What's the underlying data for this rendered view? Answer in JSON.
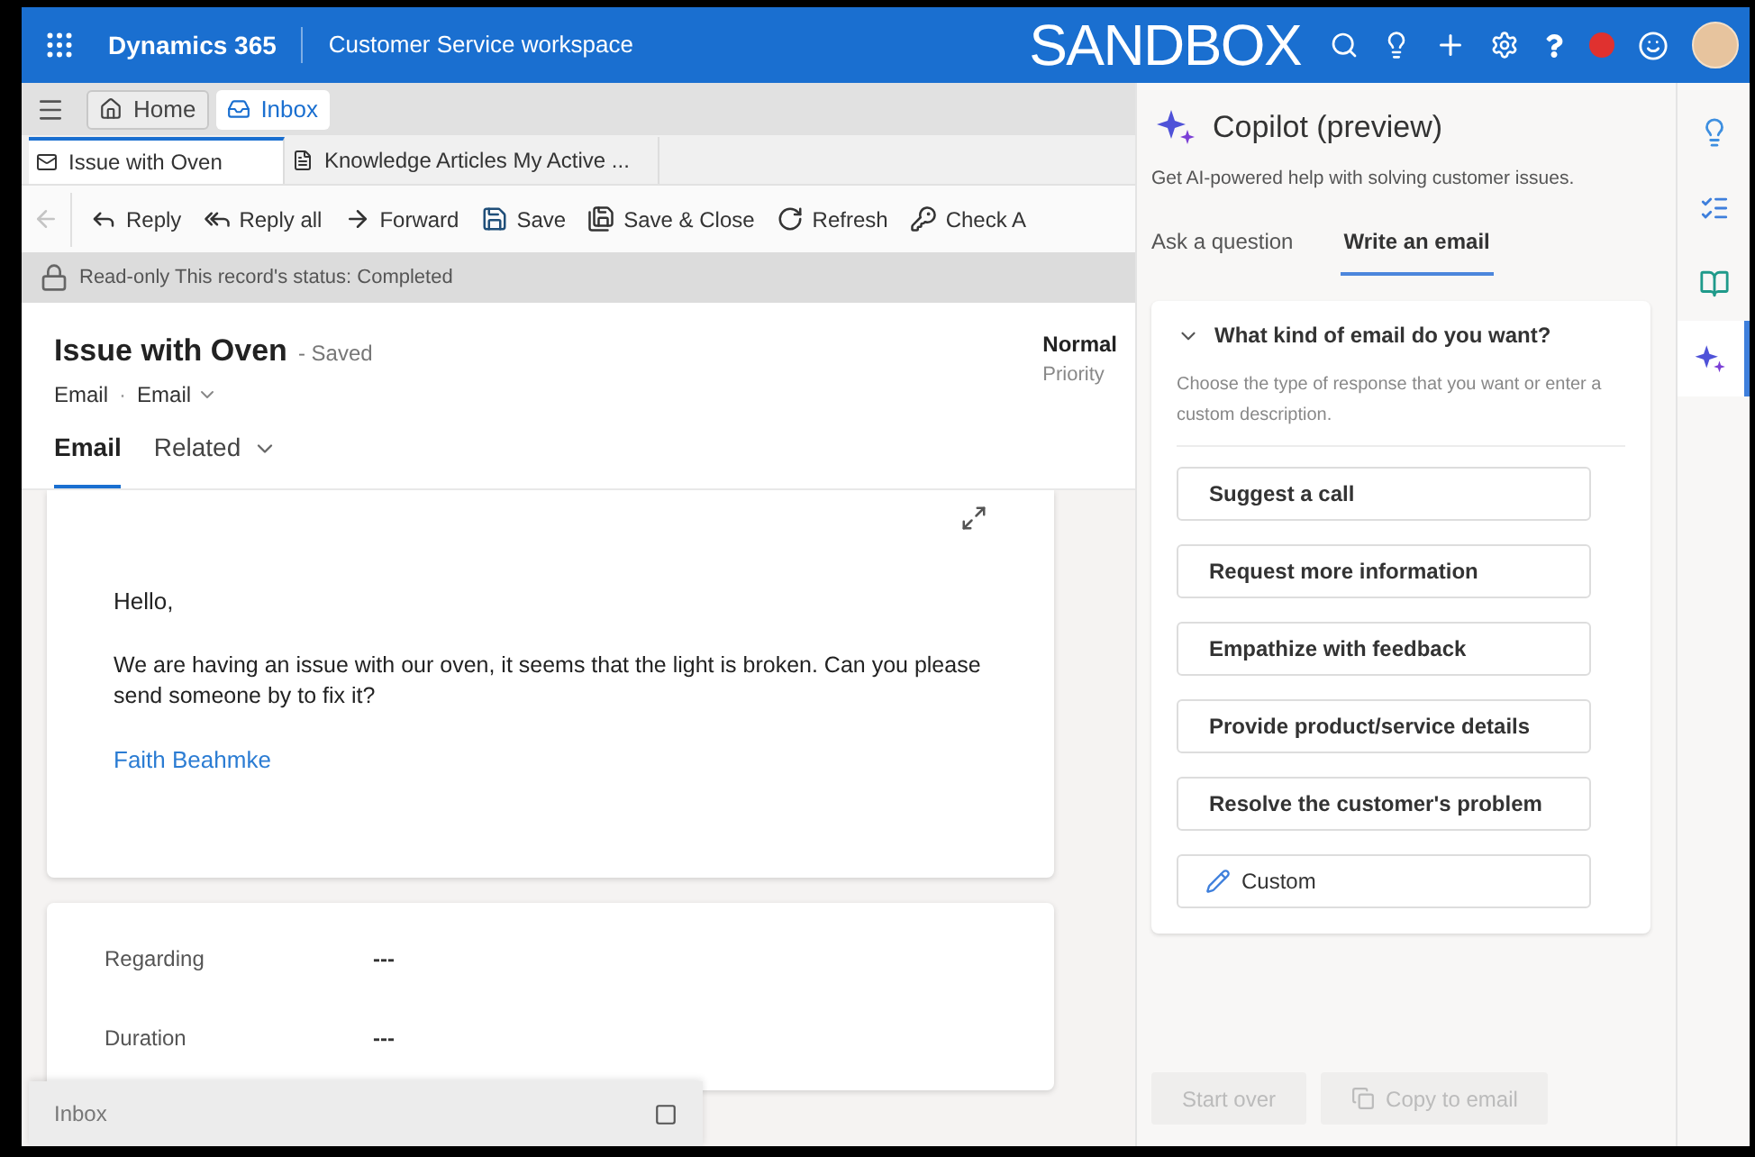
{
  "top_bar": {
    "app_name": "Dynamics 365",
    "workspace": "Customer Service workspace",
    "environment": "SANDBOX"
  },
  "nav_tabs": [
    {
      "label": "Home",
      "kind": "home",
      "selected": false
    },
    {
      "label": "Inbox",
      "kind": "inbox",
      "selected": true
    }
  ],
  "session_tabs": [
    {
      "label": "Issue with Oven",
      "kind": "email",
      "selected": true
    },
    {
      "label": "Knowledge Articles My Active ...",
      "kind": "article",
      "selected": false
    }
  ],
  "toolbar": [
    {
      "kind": "back",
      "disabled": true
    },
    {
      "kind": "reply",
      "label": "Reply",
      "disabled": false
    },
    {
      "kind": "reply_all",
      "label": "Reply all",
      "disabled": false
    },
    {
      "kind": "forward",
      "label": "Forward",
      "disabled": false
    },
    {
      "kind": "save",
      "label": "Save",
      "disabled": false
    },
    {
      "kind": "save_close",
      "label": "Save & Close",
      "disabled": false
    },
    {
      "kind": "refresh",
      "label": "Refresh",
      "disabled": false
    },
    {
      "kind": "check",
      "label": "Check A",
      "disabled": false
    }
  ],
  "notice": "Read-only This record's status: Completed",
  "record": {
    "title": "Issue with Oven",
    "status": "- Saved",
    "entity": "Email",
    "separator": "·",
    "form": "Email",
    "priority": "Normal",
    "priority_label": "Priority"
  },
  "form_tabs": [
    {
      "label": "Email",
      "selected": true,
      "dropdown": false
    },
    {
      "label": "Related",
      "selected": false,
      "dropdown": true
    }
  ],
  "email": {
    "greeting": "Hello,",
    "body": "We are having an issue with our oven, it seems that the light is broken. Can you please send someone by to fix it?",
    "signature": "Faith Beahmke"
  },
  "details": [
    {
      "label": "Regarding",
      "value": "---"
    },
    {
      "label": "Duration",
      "value": "---"
    }
  ],
  "minimized": {
    "label": "Inbox"
  },
  "copilot": {
    "title": "Copilot (preview)",
    "subtitle": "Get AI-powered help with solving customer issues.",
    "tabs": [
      {
        "label": "Ask a question",
        "selected": false
      },
      {
        "label": "Write an email",
        "selected": true
      }
    ],
    "section": {
      "title": "What kind of email do you want?",
      "expanded": true,
      "description": "Choose the type of response that you want or enter a custom description.",
      "options": [
        {
          "label": "Suggest a call",
          "kind": "preset"
        },
        {
          "label": "Request more information",
          "kind": "preset"
        },
        {
          "label": "Empathize with feedback",
          "kind": "preset"
        },
        {
          "label": "Provide product/service details",
          "kind": "preset"
        },
        {
          "label": "Resolve the customer's problem",
          "kind": "preset"
        },
        {
          "label": "Custom",
          "kind": "custom"
        }
      ]
    },
    "footer": [
      {
        "label": "Start over",
        "kind": "plain",
        "disabled": true
      },
      {
        "label": "Copy to email",
        "kind": "copy",
        "disabled": true
      }
    ]
  },
  "rail": [
    {
      "kind": "ideas",
      "selected": false
    },
    {
      "kind": "tasks",
      "selected": false
    },
    {
      "kind": "knowledge",
      "selected": false
    },
    {
      "kind": "copilot",
      "selected": true
    }
  ]
}
